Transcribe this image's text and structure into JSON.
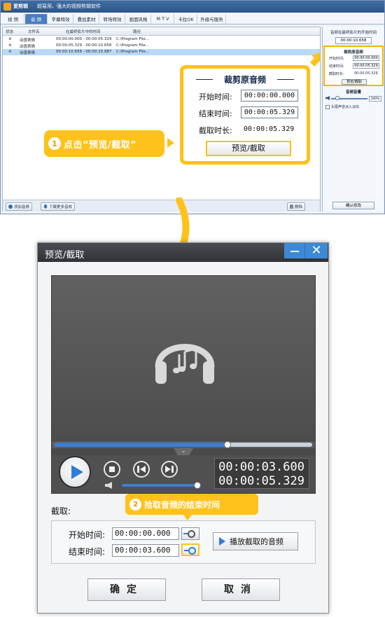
{
  "app": {
    "name": "爱剪辑",
    "slogan": "超易用、强大的视频剪辑软件",
    "tabs": [
      "视  频",
      "音  频",
      "字幕特效",
      "叠加素材",
      "转场特效",
      "画面风格",
      "M T V",
      "卡拉OK",
      "升级与服务"
    ],
    "active_tab": 1,
    "columns": [
      "状态",
      "文件名",
      "在最终影片中的时间",
      "路径"
    ],
    "rows": [
      {
        "status": "※",
        "name": "动感表情",
        "time": "00:00:00.000 - 00:00:05.329",
        "path": "C:\\Program File..."
      },
      {
        "status": "※",
        "name": "动感表情",
        "time": "00:00:05.329 - 00:00:10.658",
        "path": "C:\\Program File..."
      },
      {
        "status": "※",
        "name": "动感表情",
        "time": "00:00:10.658 - 00:00:15.987",
        "path": "C:\\Program File..."
      }
    ],
    "add_audio": "添加音频",
    "download_more": "下载更多音效",
    "delete": "删除"
  },
  "right_panel": {
    "head": "音频在最终影片的开始时间",
    "start_time": "00:00:10.658",
    "box_title": "裁剪原音频",
    "start_label": "开始时间:",
    "start_value": "00:00:00.000",
    "end_label": "结束时间:",
    "end_value": "00:00:05.329",
    "dur_label": "截取时长:",
    "dur_value": "00:00:05.329",
    "preview_btn": "预览/截取",
    "volume_title": "音频音量",
    "volume_pct": "100%",
    "fade_label": "头尾声音淡入淡出",
    "confirm": "确认修改"
  },
  "callout": {
    "title": "裁剪原音频",
    "start_label": "开始时间:",
    "start_value": "00:00:00.000",
    "end_label": "结束时间:",
    "end_value": "00:00:05.329",
    "dur_label": "截取时长:",
    "dur_value": "00:00:05.329",
    "button": "预览/截取"
  },
  "step1": {
    "num": "1",
    "text": "点击“预览/截取”"
  },
  "dialog": {
    "title": "预览/截取",
    "close_glyph": "✕",
    "collapse_glyph": "⌄",
    "progress": 0.67,
    "volume": 1.0,
    "time_current": "00:00:03.600",
    "time_total": "00:00:05.329",
    "cut_label": "截取:",
    "start_label": "开始时间:",
    "start_value": "00:00:00.000",
    "end_label": "结束时间:",
    "end_value": "00:00:03.600",
    "play_cut": "播放截取的音频",
    "ok": "确定",
    "cancel": "取消"
  },
  "step2": {
    "num": "2",
    "text": "拾取音频的结束时间"
  },
  "colors": {
    "accent_yellow": "#ffc21a",
    "accent_blue": "#3d7ed1",
    "title_dark": "#2f3236"
  }
}
